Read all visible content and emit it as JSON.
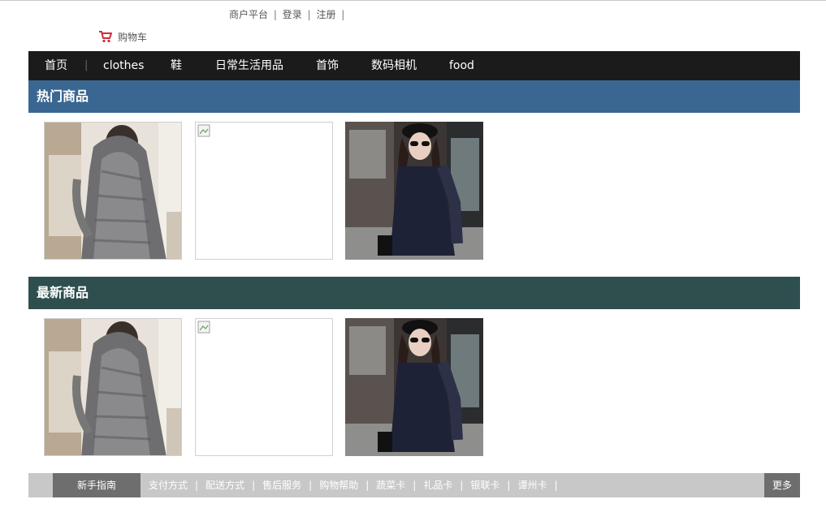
{
  "header": {
    "merchant_label": "商户平台",
    "login_label": "登录",
    "register_label": "注册",
    "separator": "|",
    "cart_label": "购物车"
  },
  "nav": {
    "items": [
      {
        "label": "首页"
      },
      {
        "label": "clothes"
      },
      {
        "label": "鞋"
      },
      {
        "label": "日常生活用品"
      },
      {
        "label": "首饰"
      },
      {
        "label": "数码相机"
      },
      {
        "label": "food"
      }
    ],
    "separator": "|"
  },
  "hot_section": {
    "title": "热门商品",
    "products": [
      {
        "image": "grey-knit-cardigan-photo",
        "image_broken": false
      },
      {
        "image": "broken-image",
        "image_broken": true
      },
      {
        "image": "navy-coat-woman-photo",
        "image_broken": false
      }
    ]
  },
  "new_section": {
    "title": "最新商品",
    "products": [
      {
        "image": "grey-knit-cardigan-photo",
        "image_broken": false
      },
      {
        "image": "broken-image",
        "image_broken": true
      },
      {
        "image": "navy-coat-woman-photo",
        "image_broken": false
      }
    ]
  },
  "footer": {
    "guide_label": "新手指南",
    "links": [
      {
        "label": "支付方式"
      },
      {
        "label": "配送方式"
      },
      {
        "label": "售后服务"
      },
      {
        "label": "购物帮助"
      },
      {
        "label": "蔬菜卡"
      },
      {
        "label": "礼品卡"
      },
      {
        "label": "银联卡"
      },
      {
        "label": "谭州卡"
      }
    ],
    "separator": "|",
    "more_label": "更多"
  },
  "colors": {
    "navbar_bg": "#1b1b1b",
    "hot_bar_bg": "#3a6791",
    "new_bar_bg": "#2f4f4f",
    "footer_bg": "#c8c8c8",
    "footer_accent": "#6e6e6e",
    "cart_icon": "#d42a3a"
  }
}
